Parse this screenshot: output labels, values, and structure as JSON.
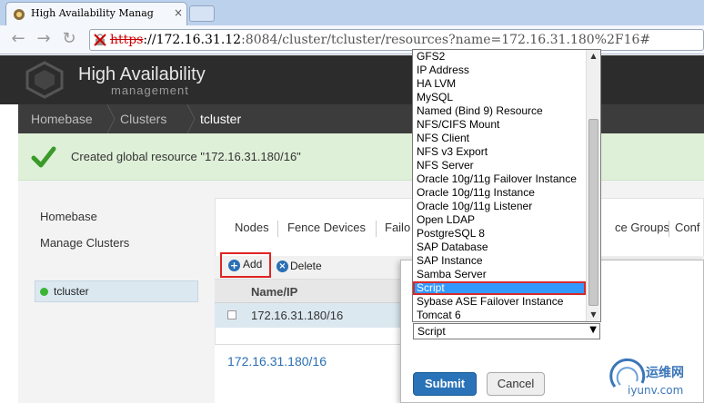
{
  "browser": {
    "tab_title": "High Availability Manag",
    "tab_close": "×",
    "nav_back": "←",
    "nav_forward": "→",
    "nav_reload": "↻",
    "url_scheme": "https",
    "url_host": "://172.16.31.12",
    "url_rest": ":8084/cluster/tcluster/resources?name=172.16.31.180%2F16#"
  },
  "header": {
    "title": "High Availability",
    "subtitle": "management"
  },
  "breadcrumb": {
    "items": [
      "Homebase",
      "Clusters",
      "tcluster"
    ]
  },
  "notice": {
    "message": "Created global resource \"172.16.31.180/16\""
  },
  "sidebar": {
    "links": [
      "Homebase",
      "Manage Clusters"
    ],
    "cluster": "tcluster"
  },
  "main": {
    "tabs": [
      "Nodes",
      "Fence Devices",
      "Failo",
      "ce Groups",
      "Conf"
    ],
    "add_label": "Add",
    "delete_label": "Delete",
    "column_name": "Name/IP",
    "rows": [
      "172.16.31.180/16"
    ],
    "detail_title": "172.16.31.180/16"
  },
  "dialog": {
    "submit_label": "Submit",
    "cancel_label": "Cancel",
    "select_value": "Script"
  },
  "dropdown": {
    "options": [
      "GFS2",
      "IP Address",
      "HA LVM",
      "MySQL",
      "Named (Bind 9) Resource",
      "NFS/CIFS Mount",
      "NFS Client",
      "NFS v3 Export",
      "NFS Server",
      "Oracle 10g/11g Failover Instance",
      "Oracle 10g/11g Instance",
      "Oracle 10g/11g Listener",
      "Open LDAP",
      "PostgreSQL 8",
      "SAP Database",
      "SAP Instance",
      "Samba Server",
      "Script",
      "Sybase ASE Failover Instance",
      "Tomcat 6"
    ],
    "selected": "Script"
  },
  "watermark": {
    "cn": "运维网",
    "url": "iyunv.com"
  },
  "colors": {
    "accent": "#2a73b8",
    "highlight_border": "#e02424",
    "success": "#3ab534"
  }
}
